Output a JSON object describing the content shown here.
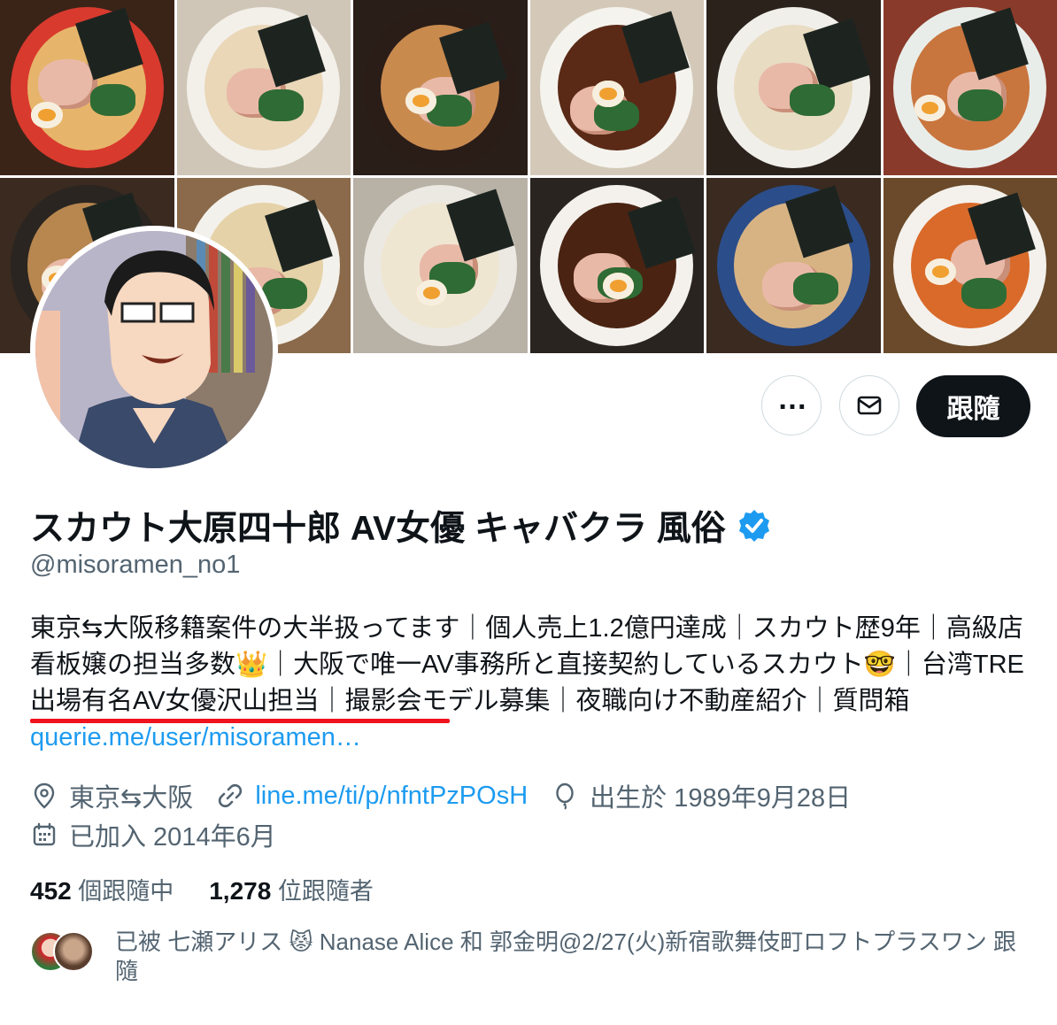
{
  "profile": {
    "display_name": "スカウト大原四十郎 AV女優 キャバクラ 風俗",
    "verified_icon": "verified-badge-icon",
    "handle": "@misoramen_no1",
    "bio_text": "東京⇆大阪移籍案件の大半扱ってます｜個人売上1.2億円達成｜スカウト歴9年｜高級店看板嬢の担当多数👑｜大阪で唯一AV事務所と直接契約しているスカウト🤓｜台湾TRE出場有名AV女優沢山担当｜撮影会モデル募集｜夜職向け不動産紹介｜質問箱",
    "bio_link": "querie.me/user/misoramen…",
    "location": "東京⇆大阪",
    "website": "line.me/ti/p/nfntPzPOsH",
    "birthday": "出生於 1989年9月28日",
    "joined": "已加入 2014年6月"
  },
  "actions": {
    "more_label": "…",
    "message_icon": "mail-icon",
    "follow_label": "跟隨"
  },
  "stats": {
    "following_count": "452",
    "following_label": "個跟隨中",
    "followers_count": "1,278",
    "followers_label": "位跟隨者"
  },
  "followed_by": {
    "text": "已被 七瀬アリス 😾 Nanase Alice 和 郭金明@2/27(火)新宿歌舞伎町ロフトプラスワン 跟隨"
  },
  "colors": {
    "accent": "#1d9bf0",
    "text": "#0f1419",
    "muted": "#536471",
    "follow_button": "#0f1419",
    "underline": "#f0121c"
  }
}
